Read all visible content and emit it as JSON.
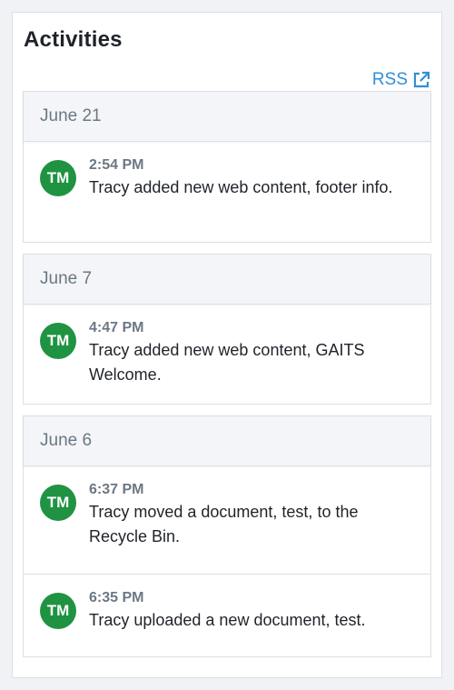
{
  "panel": {
    "title": "Activities",
    "rss_label": "RSS",
    "rss_icon": "external-link-icon",
    "avatar_color": "#1f9341",
    "link_color": "#2f8fd6"
  },
  "days": [
    {
      "date": "June 21",
      "entries": [
        {
          "initials": "TM",
          "time": "2:54 PM",
          "text": "Tracy added new web content, footer info."
        }
      ]
    },
    {
      "date": "June 7",
      "entries": [
        {
          "initials": "TM",
          "time": "4:47 PM",
          "text": "Tracy added new web content, GAITS Welcome."
        }
      ]
    },
    {
      "date": "June 6",
      "entries": [
        {
          "initials": "TM",
          "time": "6:37 PM",
          "text": "Tracy moved a document, test, to the Recycle Bin."
        },
        {
          "initials": "TM",
          "time": "6:35 PM",
          "text": "Tracy uploaded a new document, test."
        }
      ]
    }
  ]
}
